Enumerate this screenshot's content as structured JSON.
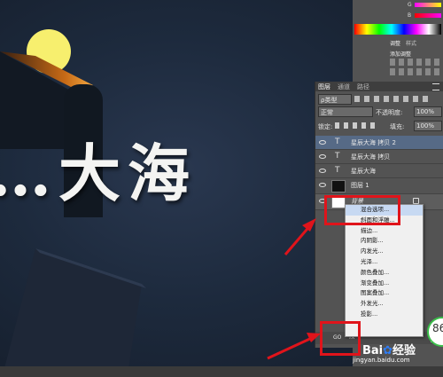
{
  "canvas_text": "…大海",
  "panels": {
    "channel_labels": [
      "G",
      "B"
    ],
    "adjust_tabs": [
      "调整",
      "样式"
    ],
    "add_adjustment": "添加调整"
  },
  "layers": {
    "tabs": [
      "图层",
      "通道",
      "路径"
    ],
    "filter_kind": "ρ类型",
    "blend_mode": "正常",
    "opacity_label": "不透明度:",
    "opacity_value": "100%",
    "lock_label": "锁定:",
    "fill_label": "填充:",
    "fill_value": "100%",
    "items": [
      {
        "name": "星辰大海 拷贝 2",
        "type": "text"
      },
      {
        "name": "星辰大海 拷贝",
        "type": "text"
      },
      {
        "name": "星辰大海",
        "type": "text"
      },
      {
        "name": "图层 1",
        "type": "pixel"
      },
      {
        "name": "背景",
        "type": "background"
      }
    ]
  },
  "context_menu": {
    "items": [
      "混合选项...",
      "斜面和浮雕...",
      "描边...",
      "内阴影...",
      "内发光...",
      "光泽...",
      "颜色叠加...",
      "渐变叠加...",
      "图案叠加...",
      "外发光...",
      "投影..."
    ]
  },
  "bottom_icons": {
    "link": "GO",
    "fx": "fx"
  },
  "badge": "86",
  "watermark": {
    "brand": "Bai",
    "brand2": "经验",
    "url": "jingyan.baidu.com"
  },
  "colors": {
    "highlight": "#e0141b",
    "moon": "#f7ef6e"
  }
}
